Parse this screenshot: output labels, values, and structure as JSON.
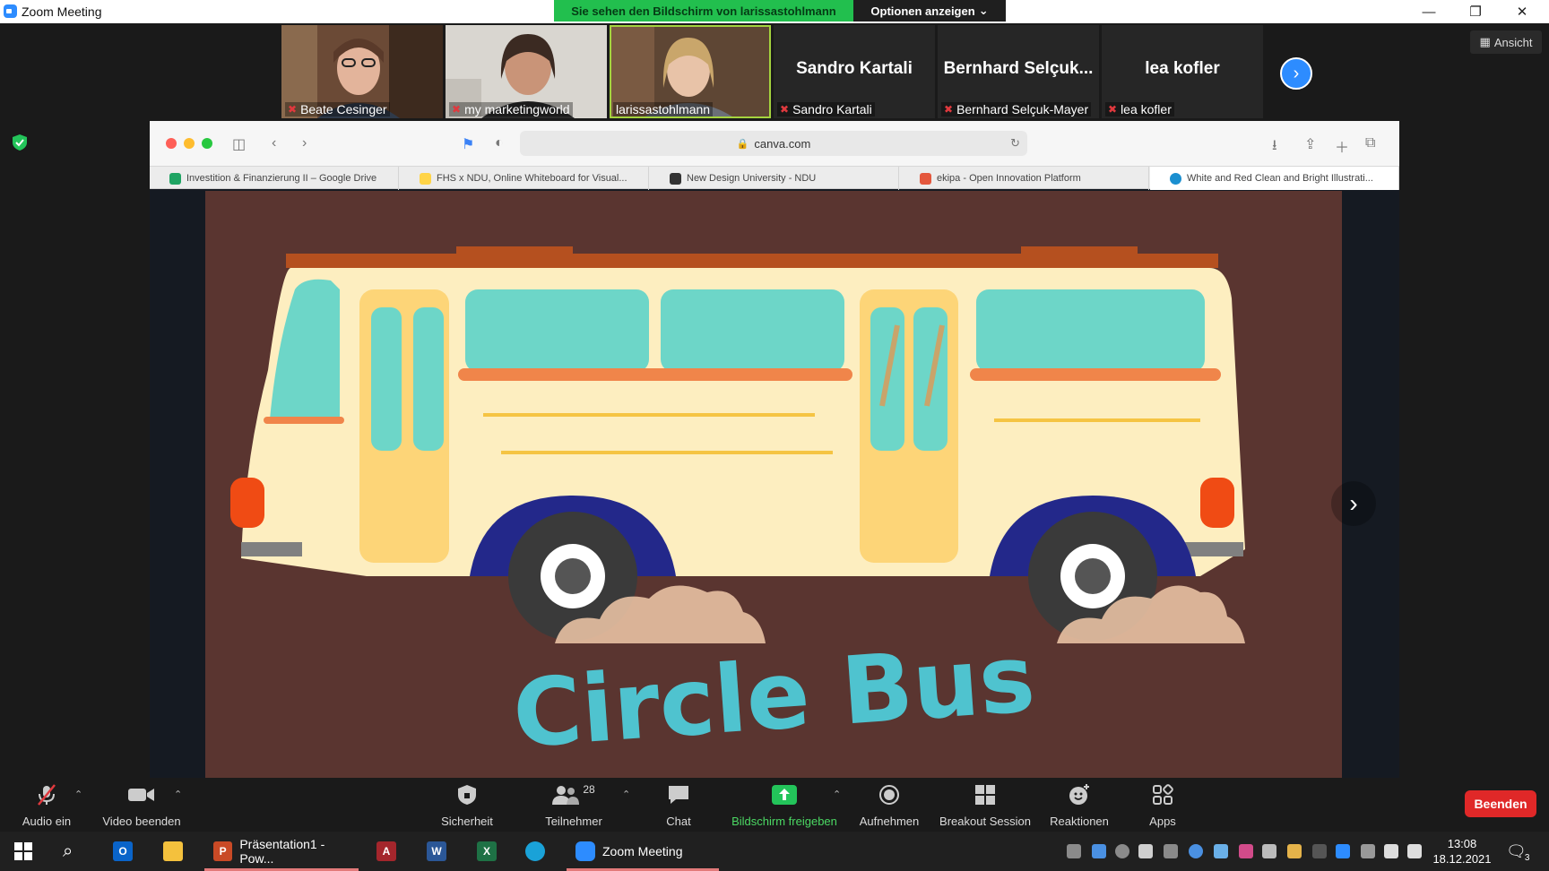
{
  "window": {
    "title": "Zoom Meeting"
  },
  "banner": {
    "sharing_text": "Sie sehen den Bildschirm von larissastohlmann",
    "options_label": "Optionen anzeigen"
  },
  "view": {
    "label": "Ansicht"
  },
  "participants": [
    {
      "name": "Beate Cesinger",
      "video": true
    },
    {
      "name": "my marketingworld",
      "video": true
    },
    {
      "name": "larissastohlmann",
      "video": true
    },
    {
      "name": "Sandro Kartali",
      "display": "Sandro Kartali",
      "video": false
    },
    {
      "name": "Bernhard Selçuk-Mayer",
      "display": "Bernhard Selçuk...",
      "video": false
    },
    {
      "name": "lea kofler",
      "display": "lea kofler",
      "video": false
    }
  ],
  "browser": {
    "url": "canva.com",
    "tabs": [
      {
        "label": "Investition & Finanzierung II – Google Drive",
        "color": "#1fa463"
      },
      {
        "label": "FHS x NDU, Online Whiteboard for Visual...",
        "color": "#ffd447"
      },
      {
        "label": "New Design University - NDU",
        "color": "#333333"
      },
      {
        "label": "ekipa - Open Innovation Platform",
        "color": "#e4573d"
      },
      {
        "label": "White and Red Clean and Bright Illustrati...",
        "color": "#1b8fd0"
      }
    ]
  },
  "slide": {
    "title": "Circle Bus",
    "colors": {
      "background": "#5a3530",
      "bus_body": "#fdeec0",
      "windows": "#6dd6c8",
      "accent": "#f0854a",
      "roof": "#b5501f",
      "title": "#4fc3cf"
    }
  },
  "controls": {
    "audio": "Audio ein",
    "video": "Video beenden",
    "security": "Sicherheit",
    "participants": "Teilnehmer",
    "participants_count": "28",
    "chat": "Chat",
    "share": "Bildschirm freigeben",
    "record": "Aufnehmen",
    "breakout": "Breakout Session",
    "reactions": "Reaktionen",
    "apps": "Apps",
    "end": "Beenden"
  },
  "taskbar": {
    "powerpoint": "Präsentation1 - Pow...",
    "zoom": "Zoom Meeting",
    "time": "13:08",
    "date": "18.12.2021",
    "notifications": "3"
  }
}
